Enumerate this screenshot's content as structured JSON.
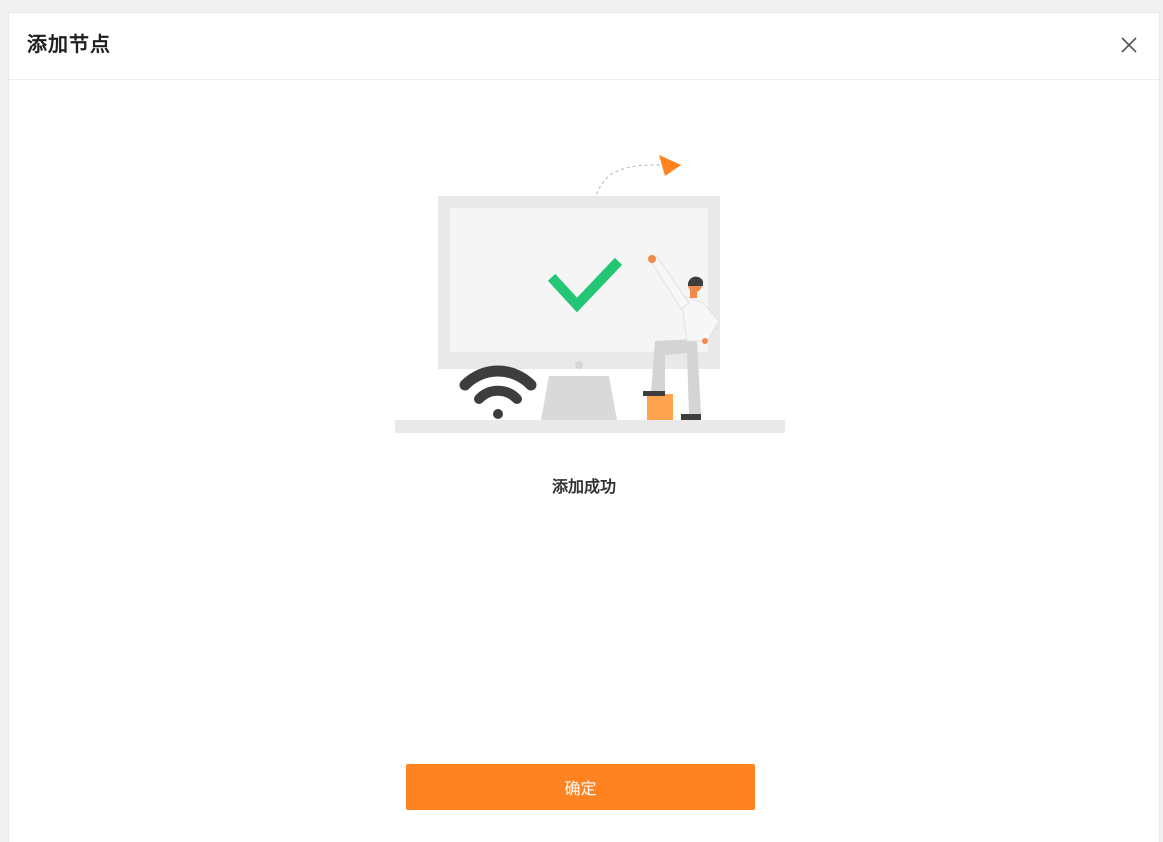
{
  "dialog": {
    "title": "添加节点",
    "close_icon": "close-icon",
    "status_text": "添加成功",
    "confirm_label": "确定"
  },
  "illustration": {
    "icons": [
      "monitor-icon",
      "check-icon",
      "wifi-icon",
      "person-icon",
      "paper-plane-icon"
    ]
  },
  "colors": {
    "accent": "#ff8320",
    "check": "#22c675",
    "wifi": "#3d3d3d",
    "monitor": "#e9e9e9"
  }
}
